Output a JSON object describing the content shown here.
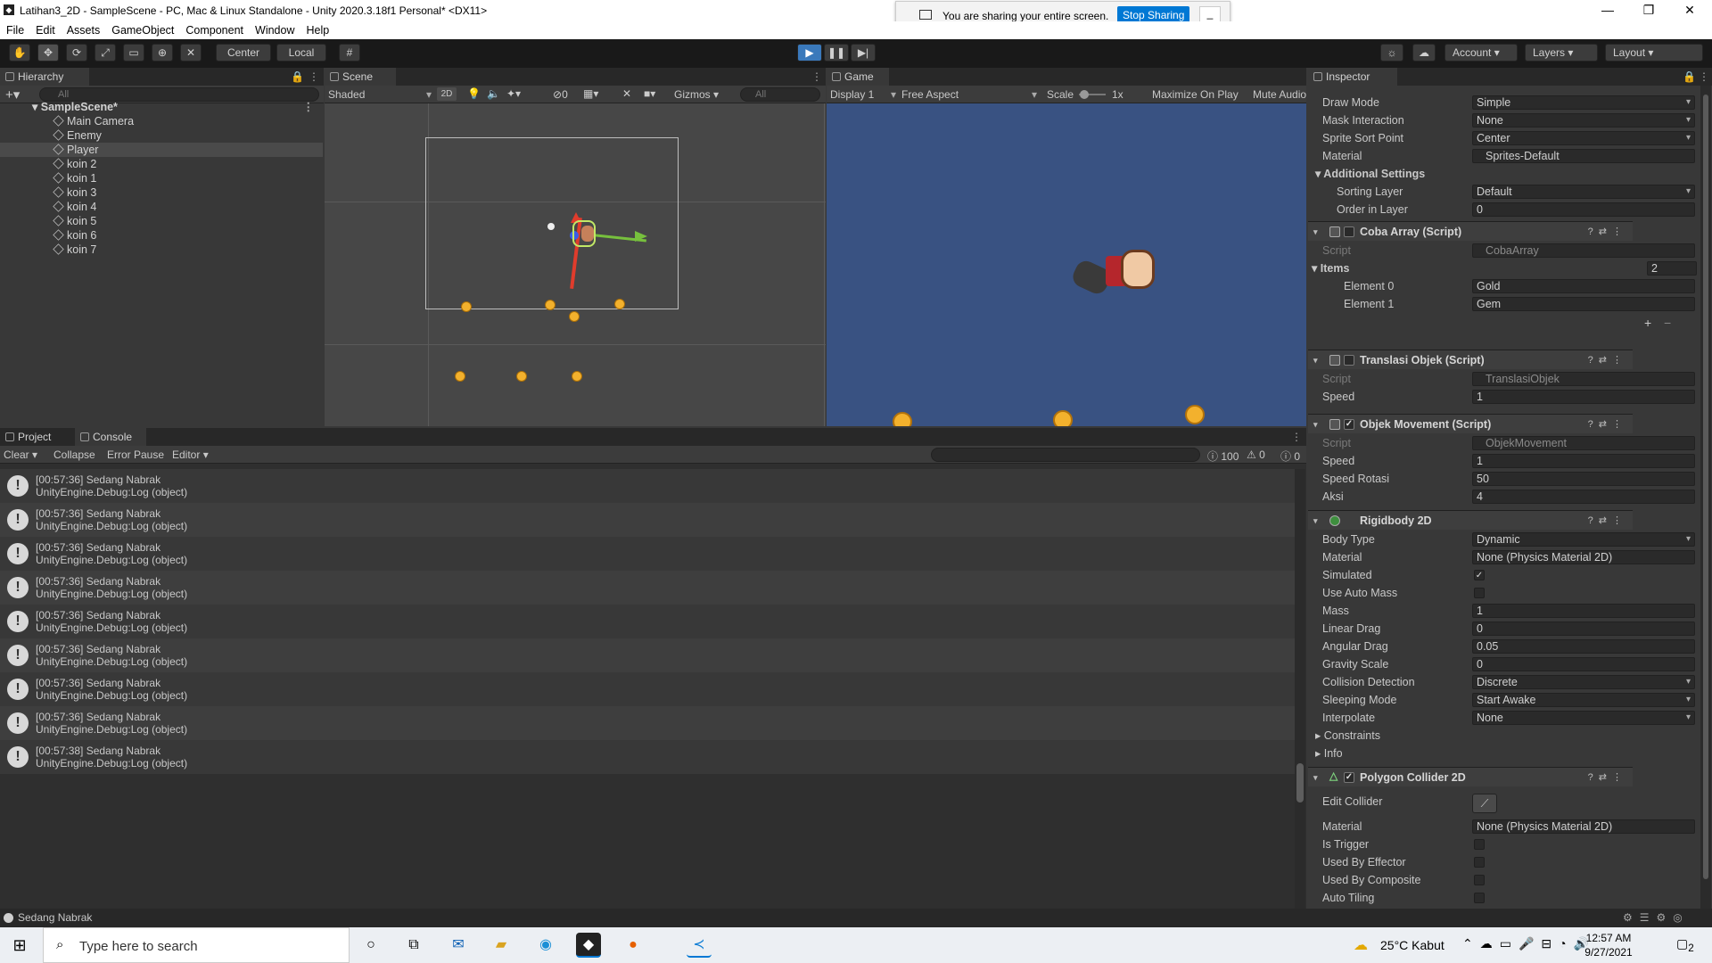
{
  "title": "Latihan3_2D - SampleScene - PC, Mac & Linux Standalone - Unity 2020.3.18f1 Personal* <DX11>",
  "sharing": {
    "text": "You are sharing your entire screen.",
    "button": "Stop Sharing",
    "minimize": "_"
  },
  "menu": [
    "File",
    "Edit",
    "Assets",
    "GameObject",
    "Component",
    "Window",
    "Help"
  ],
  "toolbar": {
    "center": "Center",
    "local": "Local",
    "account": "Account",
    "layers": "Layers",
    "layout": "Layout"
  },
  "hierarchy": {
    "tab": "Hierarchy",
    "search_placeholder": "All",
    "scene": "SampleScene*",
    "items": [
      "Main Camera",
      "Enemy",
      "Player",
      "koin 2",
      "koin 1",
      "koin 3",
      "koin 4",
      "koin 5",
      "koin 6",
      "koin 7"
    ],
    "selected_index": 2
  },
  "scene": {
    "tab": "Scene",
    "shading": "Shaded",
    "mode2d": "2D",
    "hidden_count": "0",
    "gizmos": "Gizmos",
    "search_placeholder": "All"
  },
  "game": {
    "tab": "Game",
    "display": "Display 1",
    "aspect": "Free Aspect",
    "scale_label": "Scale",
    "scale_value": "1x",
    "maximize": "Maximize On Play",
    "mute": "Mute Audio"
  },
  "console": {
    "tabs": [
      "Project",
      "Console"
    ],
    "buttons": {
      "clear": "Clear",
      "collapse": "Collapse",
      "error_pause": "Error Pause",
      "editor": "Editor"
    },
    "counts": {
      "log": "100",
      "warn": "0",
      "error": "0"
    },
    "entries": [
      {
        "time": "[00:57:36] Sedang Nabrak",
        "detail": "UnityEngine.Debug:Log (object)"
      },
      {
        "time": "[00:57:36] Sedang Nabrak",
        "detail": "UnityEngine.Debug:Log (object)"
      },
      {
        "time": "[00:57:36] Sedang Nabrak",
        "detail": "UnityEngine.Debug:Log (object)"
      },
      {
        "time": "[00:57:36] Sedang Nabrak",
        "detail": "UnityEngine.Debug:Log (object)"
      },
      {
        "time": "[00:57:36] Sedang Nabrak",
        "detail": "UnityEngine.Debug:Log (object)"
      },
      {
        "time": "[00:57:36] Sedang Nabrak",
        "detail": "UnityEngine.Debug:Log (object)"
      },
      {
        "time": "[00:57:36] Sedang Nabrak",
        "detail": "UnityEngine.Debug:Log (object)"
      },
      {
        "time": "[00:57:36] Sedang Nabrak",
        "detail": "UnityEngine.Debug:Log (object)"
      },
      {
        "time": "[00:57:38] Sedang Nabrak",
        "detail": "UnityEngine.Debug:Log (object)"
      }
    ]
  },
  "status": "Sedang Nabrak",
  "inspector": {
    "tab": "Inspector",
    "sprite": {
      "draw_mode_l": "Draw Mode",
      "draw_mode": "Simple",
      "mask_l": "Mask Interaction",
      "mask": "None",
      "sort_point_l": "Sprite Sort Point",
      "sort_point": "Center",
      "material_l": "Material",
      "material": "Sprites-Default",
      "additional": "Additional Settings",
      "sorting_layer_l": "Sorting Layer",
      "sorting_layer": "Default",
      "order_l": "Order in Layer",
      "order": "0"
    },
    "coba": {
      "title": "Coba Array (Script)",
      "script_l": "Script",
      "script": "CobaArray",
      "items_l": "Items",
      "items_count": "2",
      "e0_l": "Element 0",
      "e0": "Gold",
      "e1_l": "Element 1",
      "e1": "Gem"
    },
    "translasi": {
      "title": "Translasi Objek (Script)",
      "script_l": "Script",
      "script": "TranslasiObjek",
      "speed_l": "Speed",
      "speed": "1"
    },
    "movement": {
      "title": "Objek Movement (Script)",
      "script_l": "Script",
      "script": "ObjekMovement",
      "speed_l": "Speed",
      "speed": "1",
      "rot_l": "Speed Rotasi",
      "rot": "50",
      "aksi_l": "Aksi",
      "aksi": "4"
    },
    "rigidbody": {
      "title": "Rigidbody 2D",
      "body_type_l": "Body Type",
      "body_type": "Dynamic",
      "material_l": "Material",
      "material": "None (Physics Material 2D)",
      "simulated_l": "Simulated",
      "auto_mass_l": "Use Auto Mass",
      "mass_l": "Mass",
      "mass": "1",
      "linear_l": "Linear Drag",
      "linear": "0",
      "angular_l": "Angular Drag",
      "angular": "0.05",
      "gravity_l": "Gravity Scale",
      "gravity": "0",
      "collision_l": "Collision Detection",
      "collision": "Discrete",
      "sleep_l": "Sleeping Mode",
      "sleep": "Start Awake",
      "interp_l": "Interpolate",
      "interp": "None",
      "constraints": "Constraints",
      "info": "Info"
    },
    "polygon": {
      "title": "Polygon Collider 2D",
      "edit_l": "Edit Collider",
      "material_l": "Material",
      "material": "None (Physics Material 2D)",
      "trigger_l": "Is Trigger",
      "effector_l": "Used By Effector",
      "composite_l": "Used By Composite",
      "tiling_l": "Auto Tiling"
    }
  },
  "taskbar": {
    "search_placeholder": "Type here to search",
    "weather": "25°C  Kabut",
    "time": "12:57 AM",
    "date": "9/27/2021",
    "notif": "2"
  }
}
